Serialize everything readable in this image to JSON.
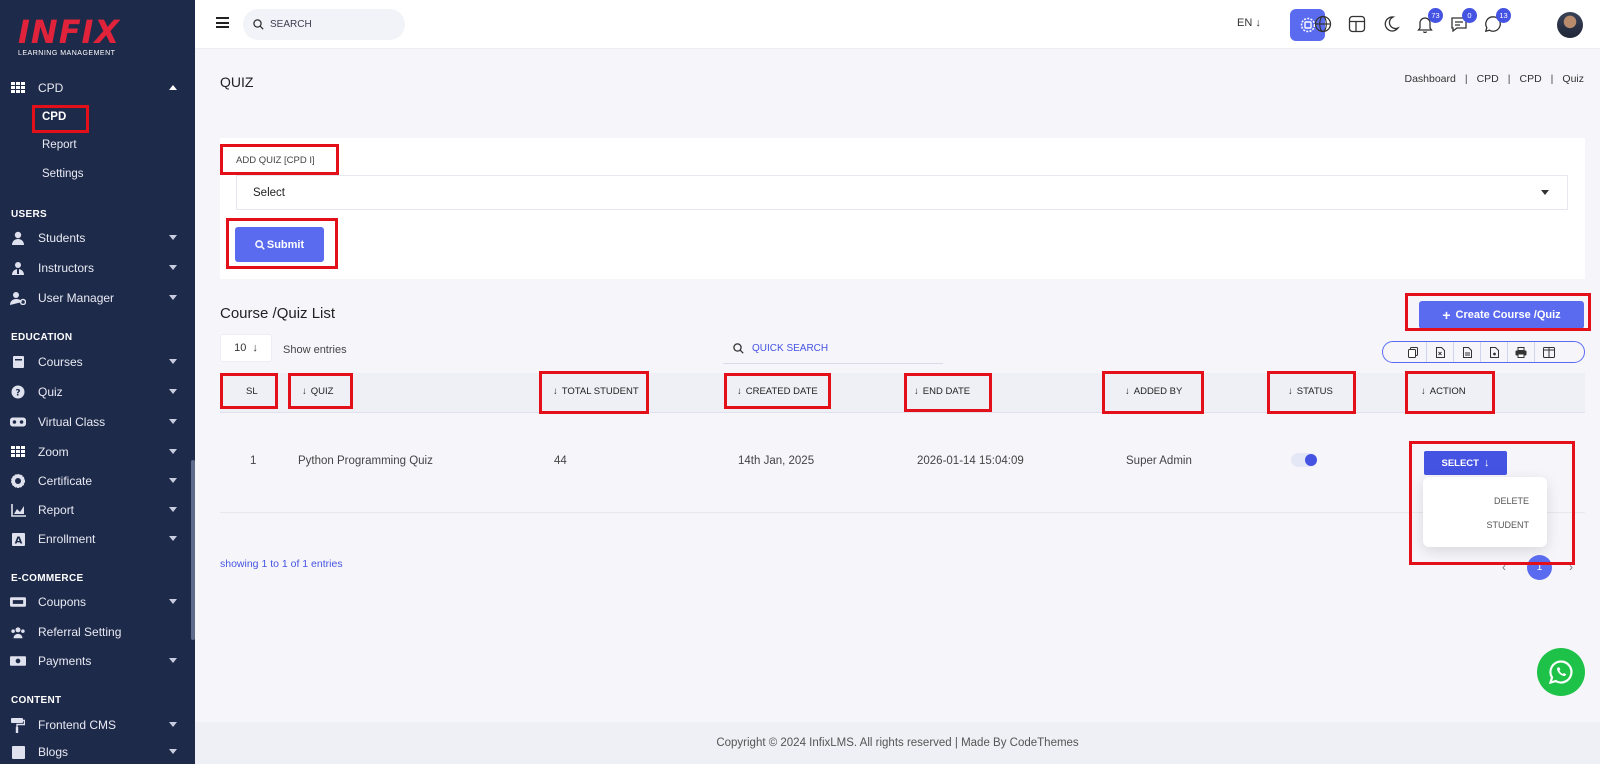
{
  "sidebar": {
    "logo": {
      "name": "INFIX",
      "sub": "LEARNING MANAGEMENT"
    },
    "cpd_menu": "CPD",
    "cpd_sub": [
      "CPD",
      "Report",
      "Settings"
    ],
    "sections": {
      "users": "USERS",
      "education": "EDUCATION",
      "ecommerce": "E-COMMERCE",
      "content": "CONTENT"
    },
    "users_items": [
      "Students",
      "Instructors",
      "User Manager"
    ],
    "education_items": [
      "Courses",
      "Quiz",
      "Virtual Class",
      "Zoom",
      "Certificate",
      "Report",
      "Enrollment"
    ],
    "ecommerce_items": [
      "Coupons",
      "Referral Setting",
      "Payments"
    ],
    "content_items": [
      "Frontend CMS",
      "Blogs"
    ]
  },
  "topbar": {
    "search_placeholder": "SEARCH",
    "lang": "EN",
    "badges": {
      "notifications": "73",
      "messages": "0",
      "whatsapp": "13"
    }
  },
  "page": {
    "title": "QUIZ",
    "breadcrumb": [
      "Dashboard",
      "CPD",
      "CPD",
      "Quiz"
    ]
  },
  "form": {
    "label": "ADD QUIZ [CPD I]",
    "select_value": "Select",
    "submit_label": "Submit"
  },
  "list": {
    "title": "Course /Quiz List",
    "create_label": "Create Course /Quiz",
    "entries_value": "10",
    "show_entries": "Show entries",
    "quick_search_placeholder": "QUICK SEARCH",
    "columns": [
      "SL",
      "QUIZ",
      "TOTAL STUDENT",
      "CREATED DATE",
      "END DATE",
      "ADDED BY",
      "STATUS",
      "ACTION"
    ],
    "rows": [
      {
        "sl": "1",
        "quiz": "Python Programming Quiz",
        "total_student": "44",
        "created_date": "14th Jan, 2025",
        "end_date": "2026-01-14 15:04:09",
        "added_by": "Super Admin",
        "status": true,
        "action": "SELECT"
      }
    ],
    "action_menu": [
      "DELETE",
      "STUDENT"
    ],
    "showing": "showing 1 to 1 of 1 entries",
    "page_prev": "‹",
    "page_current": "1",
    "page_next": "›"
  },
  "footer": "Copyright © 2024 InfixLMS. All rights reserved | Made By CodeThemes",
  "colors": {
    "sidebar": "#1e2a4a",
    "accent": "#5b6bf0",
    "highlight": "#e3101a",
    "whatsapp": "#1fc248"
  }
}
